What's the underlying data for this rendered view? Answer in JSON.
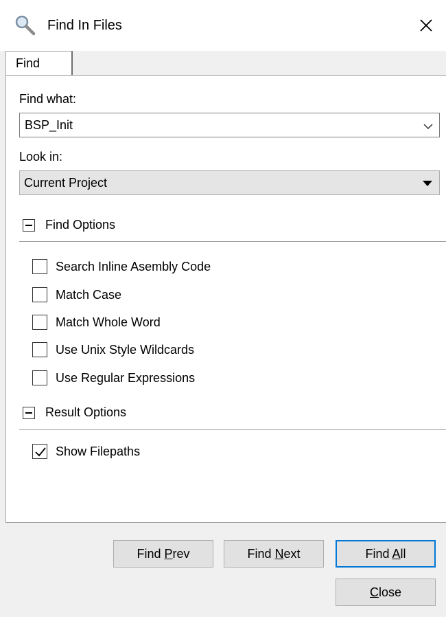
{
  "window": {
    "title": "Find In Files",
    "icon": "search-icon"
  },
  "tabs": [
    {
      "label": "Find"
    }
  ],
  "find_what": {
    "label": "Find what:",
    "value": "BSP_Init"
  },
  "look_in": {
    "label": "Look in:",
    "value": "Current Project"
  },
  "find_options": {
    "title": "Find Options",
    "items": [
      {
        "label": "Search Inline Asembly Code",
        "checked": false
      },
      {
        "label": "Match Case",
        "checked": false
      },
      {
        "label": "Match Whole Word",
        "checked": false
      },
      {
        "label": "Use Unix Style Wildcards",
        "checked": false
      },
      {
        "label": "Use Regular Expressions",
        "checked": false
      }
    ]
  },
  "result_options": {
    "title": "Result Options",
    "items": [
      {
        "label": "Show Filepaths",
        "checked": true
      }
    ]
  },
  "buttons": {
    "find_prev": {
      "pre": "Find ",
      "mnemonic": "P",
      "post": "rev"
    },
    "find_next": {
      "pre": "Find ",
      "mnemonic": "N",
      "post": "ext"
    },
    "find_all": {
      "pre": "Find ",
      "mnemonic": "A",
      "post": "ll"
    },
    "close": {
      "pre": "",
      "mnemonic": "C",
      "post": "lose"
    }
  }
}
